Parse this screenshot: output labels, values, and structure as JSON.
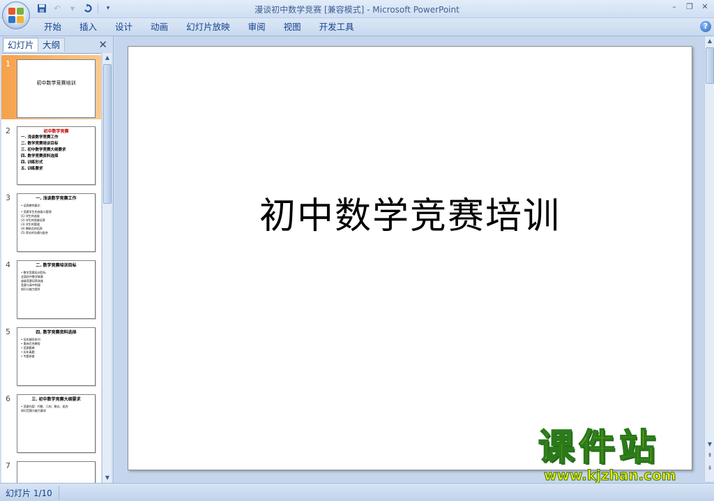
{
  "window": {
    "title": "漫谈初中数学竞赛 [兼容模式] - Microsoft PowerPoint"
  },
  "colors": {
    "accent": "#15428b",
    "selection": "#f6a14a"
  },
  "qat": {
    "icons": [
      "save-icon",
      "undo-icon",
      "redo-icon",
      "customize-icon"
    ],
    "undo_arrow": "▾"
  },
  "ribbon": {
    "tabs": [
      "开始",
      "插入",
      "设计",
      "动画",
      "幻灯片放映",
      "审阅",
      "视图",
      "开发工具"
    ]
  },
  "panel": {
    "tabs": [
      "幻灯片",
      "大纲"
    ],
    "close": "✕"
  },
  "slides": [
    {
      "num": "1",
      "center": "初中数学竞赛培训"
    },
    {
      "num": "2",
      "title": "初中数学竞赛",
      "lines": [
        "一. 浅谈数学竞赛工作",
        "二. 数学竞赛培训目标",
        "三. 初中数学竞赛大纲要求",
        "四. 数学竞赛资料选择",
        "四. 训练形式",
        "五. 训练要求"
      ]
    },
    {
      "num": "3",
      "title": "一. 浅谈数学竞赛工作",
      "small": [
        "• 培养教师意识",
        "• 竞赛学生的选拔与管理",
        "(1) 学生的选拔",
        "(2) 学生的思维培养",
        "(3) 学生的管理",
        "(4) 教练员的培养",
        "(5) 家长的沟通与配合"
      ]
    },
    {
      "num": "4",
      "title": "二. 数学竞赛培训目标",
      "small": [
        "• 数学竞赛培训目标",
        "全国初中数学联赛",
        "省级竞赛培养选拔",
        "竞赛与高中衔接",
        "知识与能力提升"
      ]
    },
    {
      "num": "5",
      "title": "四. 数学竞赛资料选择",
      "small": [
        "• 培优辅导系列",
        "• 奥林匹克教程",
        "• 竞赛题典",
        "• 历年真题",
        "• 专题讲座"
      ]
    },
    {
      "num": "6",
      "title": "三. 初中数学竞赛大纲要求",
      "small": [
        "• 竞赛内容：代数、几何、数论、组合",
        "知识范围与能力要求"
      ]
    },
    {
      "num": "7"
    }
  ],
  "main": {
    "slide_title": "初中数学竞赛培训"
  },
  "watermark": {
    "big": "课件站",
    "url": "www.kjzhan.com"
  },
  "status": {
    "slide_indicator": "幻灯片 1/10"
  }
}
